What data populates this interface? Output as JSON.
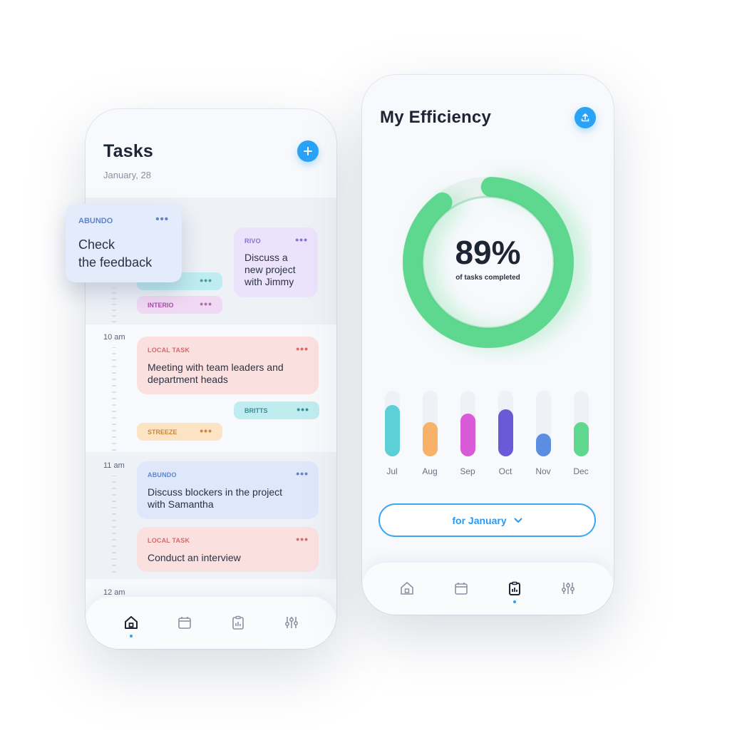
{
  "tasks_screen": {
    "title": "Tasks",
    "date": "January, 28",
    "floating_card": {
      "tag": "ABUNDO",
      "line1": "Check",
      "line2": "the feedback",
      "menu": "•••"
    },
    "cards": {
      "rivo": {
        "tag": "RIVO",
        "line1": "Discuss a",
        "line2": "new project",
        "line3": "with Jimmy",
        "menu": "•••"
      },
      "interio": {
        "tag": "INTERIO",
        "menu": "•••"
      },
      "hidden_pill": {
        "menu": "•••"
      },
      "local1": {
        "tag": "LOCAL TASK",
        "line1": "Meeting with team leaders and",
        "line2": "department heads",
        "menu": "•••"
      },
      "britts": {
        "tag": "BRITTS",
        "menu": "•••"
      },
      "streeze": {
        "tag": "STREEZE",
        "menu": "•••"
      },
      "abundo2": {
        "tag": "ABUNDO",
        "line1": "Discuss blockers in the project",
        "line2": "with Samantha",
        "menu": "•••"
      },
      "local2": {
        "tag": "LOCAL TASK",
        "line1": "Conduct an interview",
        "menu": "•••"
      }
    },
    "times": {
      "t10": "10 am",
      "t11": "11 am",
      "t12": "12 am"
    }
  },
  "efficiency_screen": {
    "title": "My Efficiency",
    "percent": "89%",
    "percent_value": 0.89,
    "caption": "of tasks completed",
    "period_button": "for January",
    "bars": [
      {
        "month": "Jul",
        "value": 0.78,
        "color": "#5dcfd6"
      },
      {
        "month": "Aug",
        "value": 0.52,
        "color": "#f7b267"
      },
      {
        "month": "Sep",
        "value": 0.65,
        "color": "#d85ad6"
      },
      {
        "month": "Oct",
        "value": 0.72,
        "color": "#6a5ad8"
      },
      {
        "month": "Nov",
        "value": 0.35,
        "color": "#5b8ee0"
      },
      {
        "month": "Dec",
        "value": 0.52,
        "color": "#5ed88f"
      }
    ]
  },
  "colors": {
    "accent": "#2aa2f5",
    "ring": "#5ed88f",
    "blue_card": "#dfe8fb",
    "purple_card": "#ebe3fb",
    "red_card": "#fbe0e0",
    "cyan_card": "#bfecef",
    "orange_card": "#fce3c4"
  },
  "icons": [
    "plus-icon",
    "upload-icon",
    "home-icon",
    "calendar-icon",
    "clipboard-chart-icon",
    "sliders-icon",
    "chevron-down-icon"
  ]
}
